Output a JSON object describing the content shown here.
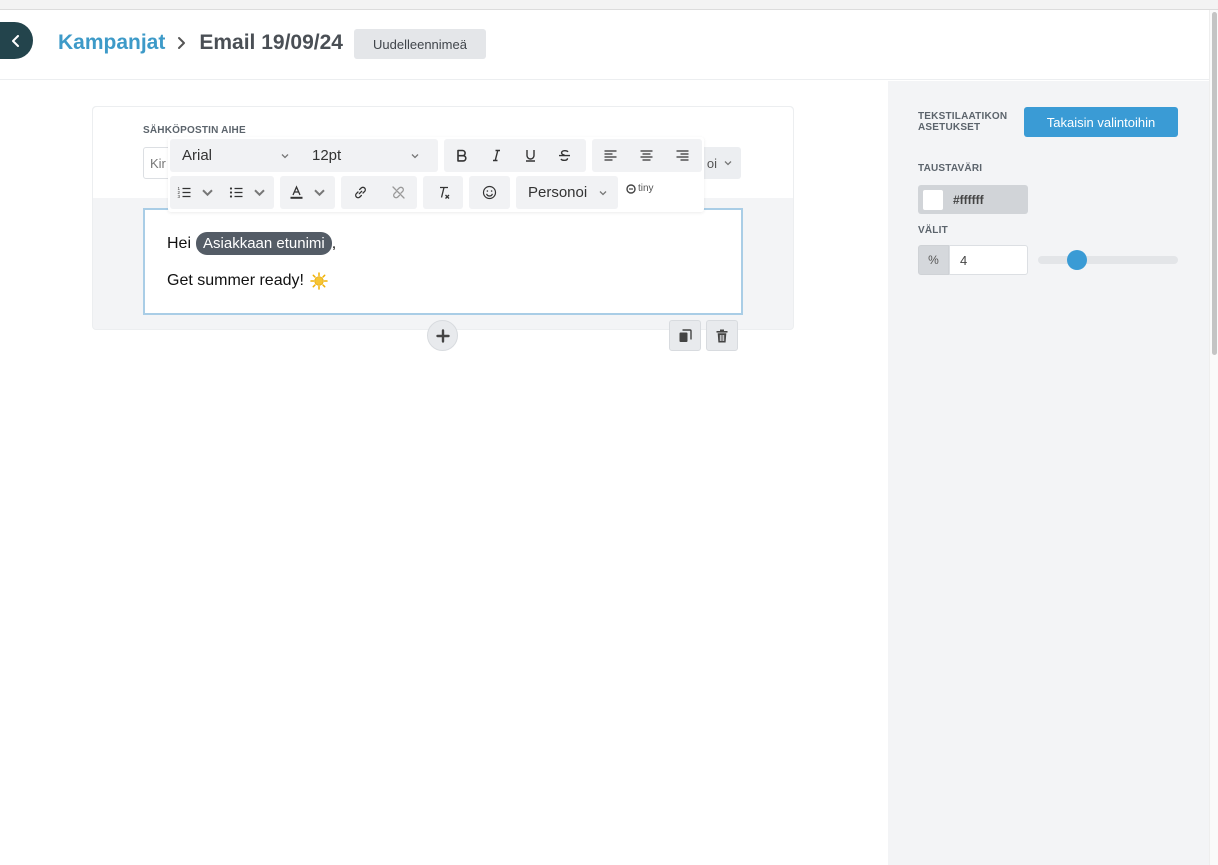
{
  "header": {
    "breadcrumb_root": "Kampanjat",
    "title": "Email 19/09/24",
    "rename_label": "Uudelleennimeä"
  },
  "editor": {
    "subject_label": "SÄHKÖPOSTIN AIHE",
    "subject_value": "Kir",
    "subject_personalize": "oi",
    "text_line1_prefix": "Hei",
    "merge_tag": "Asiakkaan etunimi",
    "text_line1_suffix": ",",
    "text_line2": "Get summer ready!",
    "text_line2_emoji": "sun-emoji"
  },
  "toolbar": {
    "font_family": "Arial",
    "font_size": "12pt",
    "personalize": "Personoi",
    "brand": "tiny"
  },
  "sidebar": {
    "heading": "TEKSTILAATIKON ASETUKSET",
    "back_button": "Takaisin valintoihin",
    "bg_label": "TAUSTAVÄRI",
    "bg_color": "#ffffff",
    "spacing_label": "VÄLIT",
    "spacing_unit": "%",
    "spacing_value": "4",
    "spacing_slider_fraction": 0.24
  },
  "colors": {
    "accent": "#3a9bd5",
    "back_button": "#23444c",
    "breadcrumb": "#3d9ac8"
  }
}
